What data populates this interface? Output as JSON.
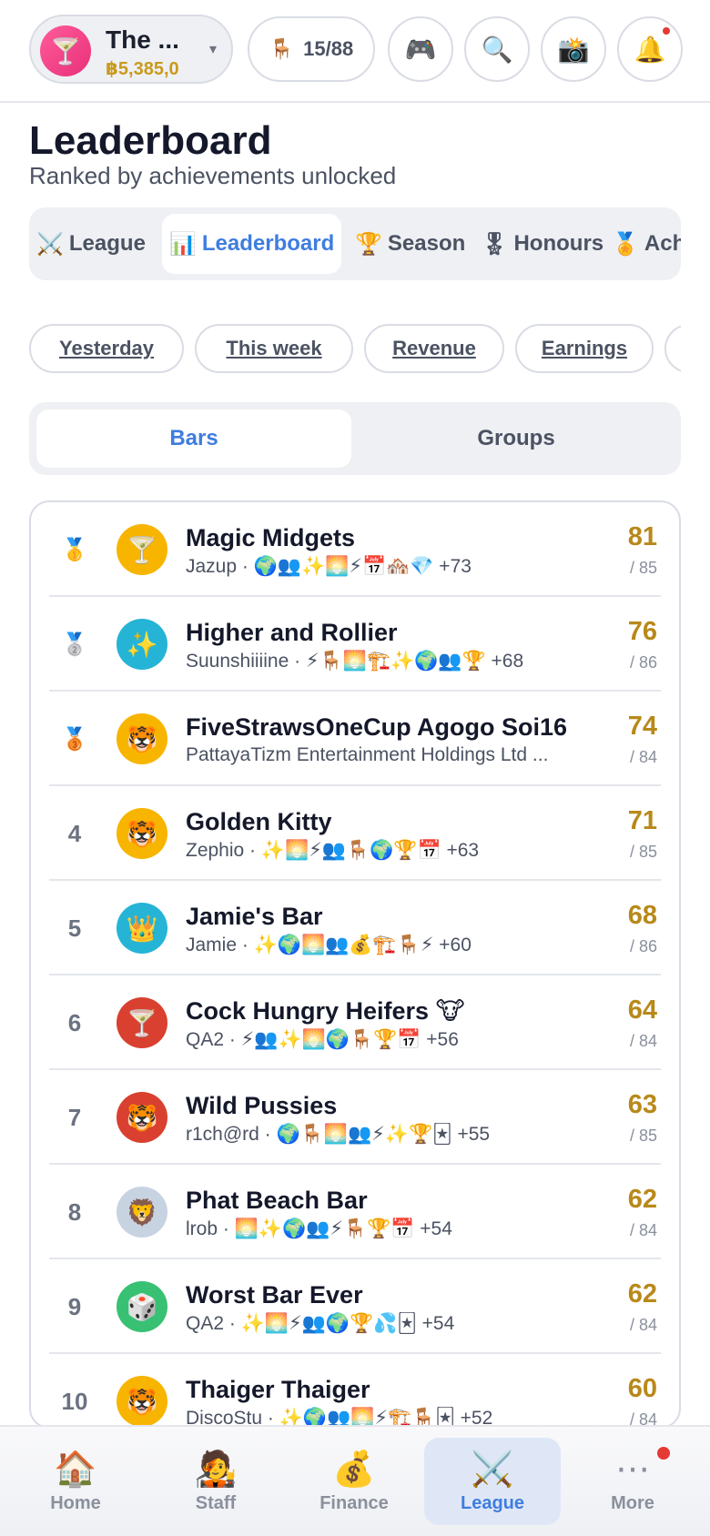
{
  "topbar": {
    "venue_icon": "🍸",
    "venue_name": "The ...",
    "venue_cash": "฿5,385,0",
    "seats_icon": "🪑",
    "seats": "15/88",
    "buttons": [
      {
        "name": "game-controller-icon",
        "icon": "🎮"
      },
      {
        "name": "search-icon",
        "icon": "🔍"
      },
      {
        "name": "camera-icon",
        "icon": "📸"
      },
      {
        "name": "bell-icon",
        "icon": "🔔"
      }
    ]
  },
  "header": {
    "title": "Leaderboard",
    "subtitle": "Ranked by achievements unlocked"
  },
  "tabs": [
    {
      "icon": "⚔️",
      "label": "League"
    },
    {
      "icon": "📊",
      "label": "Leaderboard"
    },
    {
      "icon": "🏆",
      "label": "Season"
    },
    {
      "icon": "🎖",
      "label": "Honours"
    },
    {
      "icon": "🏅",
      "label": "Achievements"
    }
  ],
  "chips": [
    "Yesterday",
    "This week",
    "Revenue",
    "Earnings",
    ""
  ],
  "segment": {
    "left": "Bars",
    "right": "Groups"
  },
  "rows": [
    {
      "rank": "🥇",
      "avatar": "🍸",
      "name": "Magic Midgets",
      "meta": "Jazup · 🌍👥✨🌅⚡📅🏘️💎 +73",
      "score": "81",
      "total": "/ 85"
    },
    {
      "rank": "🥈",
      "avatar": "✨",
      "name": "Higher and Rollier",
      "meta": "Suunshiiiine · ⚡🪑🌅🏗️✨🌍👥🏆 +68",
      "score": "76",
      "total": "/ 86"
    },
    {
      "rank": "🥉",
      "avatar": "🐯",
      "name": "FiveStrawsOneCup Agogo Soi16",
      "meta": "PattayaTizm Entertainment Holdings Ltd ...",
      "score": "74",
      "total": "/ 84"
    },
    {
      "rank": "4",
      "avatar": "🐯",
      "name": "Golden Kitty",
      "meta": "Zephio · ✨🌅⚡👥🪑🌍🏆📅 +63",
      "score": "71",
      "total": "/ 85"
    },
    {
      "rank": "5",
      "avatar": "👑",
      "name": "Jamie's Bar",
      "meta": "Jamie · ✨🌍🌅👥💰🏗️🪑⚡ +60",
      "score": "68",
      "total": "/ 86"
    },
    {
      "rank": "6",
      "avatar": "🍸",
      "name": "Cock Hungry Heifers 🐮",
      "meta": "QA2 · ⚡👥✨🌅🌍🪑🏆📅 +56",
      "score": "64",
      "total": "/ 84"
    },
    {
      "rank": "7",
      "avatar": "🐯",
      "name": "Wild Pussies",
      "meta": "r1ch@rd · 🌍🪑🌅👥⚡✨🏆🃏 +55",
      "score": "63",
      "total": "/ 85"
    },
    {
      "rank": "8",
      "avatar": "🦁",
      "name": "Phat Beach Bar",
      "meta": "lrob · 🌅✨🌍👥⚡🪑🏆📅 +54",
      "score": "62",
      "total": "/ 84"
    },
    {
      "rank": "9",
      "avatar": "🎲",
      "name": "Worst Bar Ever",
      "meta": "QA2 · ✨🌅⚡👥🌍🏆💦🃏 +54",
      "score": "62",
      "total": "/ 84"
    },
    {
      "rank": "10",
      "avatar": "🐯",
      "name": "Thaiger Thaiger",
      "meta": "DiscoStu · ✨🌍👥🌅⚡🏗️🪑🃏 +52",
      "score": "60",
      "total": "/ 84"
    }
  ],
  "avatar_colors": [
    "#f7b500",
    "#25b4d6",
    "#f7b500",
    "#f7b500",
    "#25b4d6",
    "#d9402f",
    "#d9402f",
    "#c8d3e2",
    "#38c172",
    "#f7b500"
  ],
  "nav": [
    {
      "icon": "🏠",
      "label": "Home"
    },
    {
      "icon": "🧑‍🎤",
      "label": "Staff"
    },
    {
      "icon": "💰",
      "label": "Finance"
    },
    {
      "icon": "⚔️",
      "label": "League"
    },
    {
      "icon": "⋯",
      "label": "More"
    }
  ]
}
